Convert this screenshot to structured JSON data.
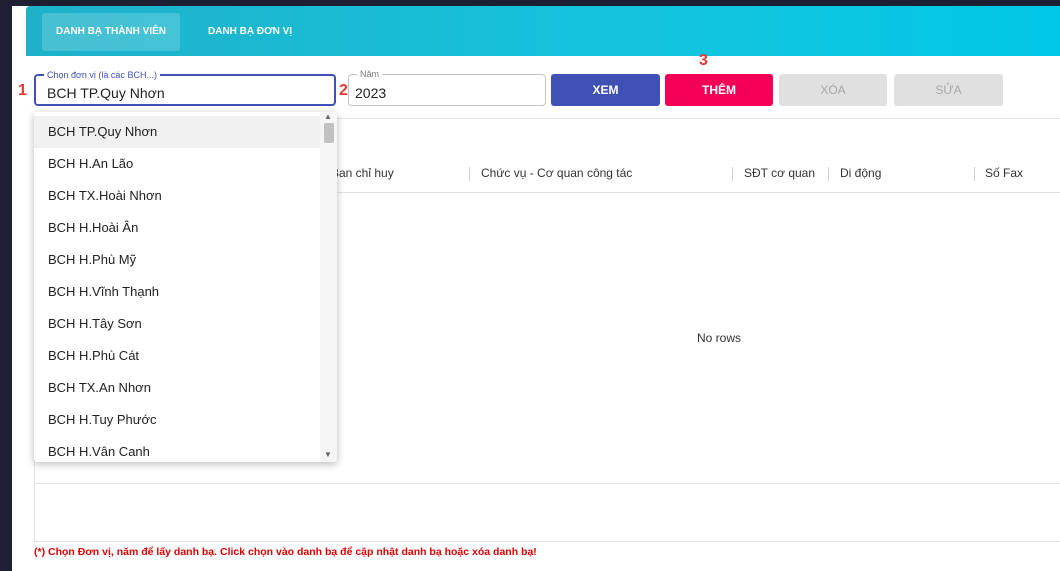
{
  "tabs": [
    {
      "label": "DANH BẠ THÀNH VIÊN",
      "active": true
    },
    {
      "label": "DANH BẠ ĐƠN VỊ",
      "active": false
    }
  ],
  "form": {
    "unit_label": "Chọn đơn vị (là các BCH...)",
    "unit_value": "BCH TP.Quy Nhơn",
    "year_label": "Năm",
    "year_value": "2023"
  },
  "markers": {
    "m1": "1",
    "m2": "2",
    "m3": "3"
  },
  "buttons": {
    "xem": "XEM",
    "them": "THÊM",
    "xoa": "XÓA",
    "sua": "SỬA"
  },
  "dropdown": {
    "options": [
      "BCH TP.Quy Nhơn",
      "BCH H.An Lão",
      "BCH TX.Hoài Nhơn",
      "BCH H.Hoài Ân",
      "BCH H.Phù Mỹ",
      "BCH H.Vĩnh Thạnh",
      "BCH H.Tây Sơn",
      "BCH H.Phù Cát",
      "BCH TX.An Nhơn",
      "BCH H.Tuy Phước",
      "BCH H.Vân Canh"
    ],
    "selected_index": 0
  },
  "table": {
    "columns": [
      "Ban chỉ huy",
      "Chức vụ - Cơ quan công tác",
      "SĐT cơ quan",
      "Di động",
      "Số Fax"
    ],
    "empty_text": "No rows"
  },
  "note": "(*) Chọn Đơn vị, năm để lấy danh bạ. Click chọn vào danh bạ để cập nhật danh bạ hoặc xóa danh bạ!",
  "colors": {
    "primary": "#3f51b5",
    "secondary": "#f50057",
    "tabbar": "#14c4de",
    "marker": "#e53935",
    "note": "#e00000"
  }
}
